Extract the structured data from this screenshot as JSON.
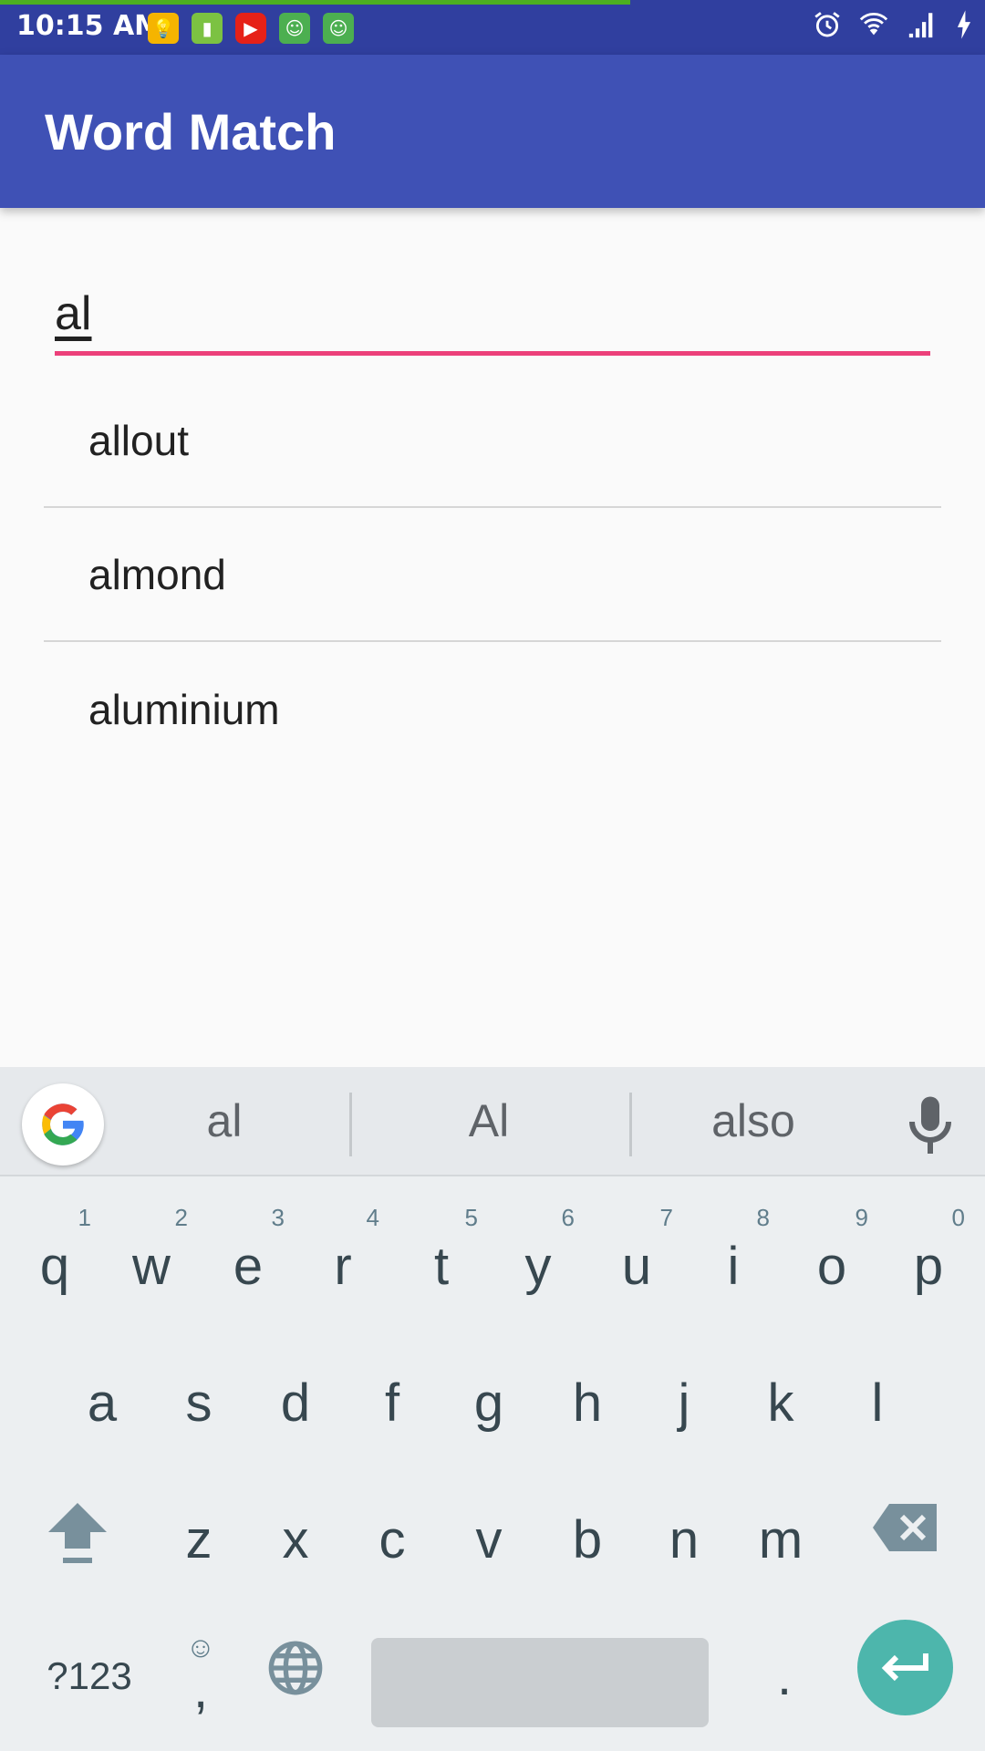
{
  "status_bar": {
    "time": "10:15 AM",
    "progress": 0.64,
    "notification_icons": [
      "lightbulb-icon",
      "battery-app-icon",
      "youtube-icon",
      "android-icon",
      "android-icon"
    ],
    "system_icons": [
      "alarm-icon",
      "wifi-icon",
      "signal-icon",
      "charging-icon"
    ]
  },
  "app_bar": {
    "title": "Word Match"
  },
  "search": {
    "value": "al"
  },
  "results": [
    "allout",
    "almond",
    "aluminium"
  ],
  "keyboard": {
    "suggestions": [
      "al",
      "Al",
      "also"
    ],
    "row1": [
      {
        "key": "q",
        "num": "1"
      },
      {
        "key": "w",
        "num": "2"
      },
      {
        "key": "e",
        "num": "3"
      },
      {
        "key": "r",
        "num": "4"
      },
      {
        "key": "t",
        "num": "5"
      },
      {
        "key": "y",
        "num": "6"
      },
      {
        "key": "u",
        "num": "7"
      },
      {
        "key": "i",
        "num": "8"
      },
      {
        "key": "o",
        "num": "9"
      },
      {
        "key": "p",
        "num": "0"
      }
    ],
    "row2": [
      "a",
      "s",
      "d",
      "f",
      "g",
      "h",
      "j",
      "k",
      "l"
    ],
    "row3": [
      "z",
      "x",
      "c",
      "v",
      "b",
      "n",
      "m"
    ],
    "symbols_label": "?123",
    "comma_label": ",",
    "period_label": "."
  },
  "colors": {
    "status_bar": "#303F9F",
    "app_bar": "#3F51B5",
    "accent": "#EC407A",
    "enter": "#4DB6AC"
  }
}
